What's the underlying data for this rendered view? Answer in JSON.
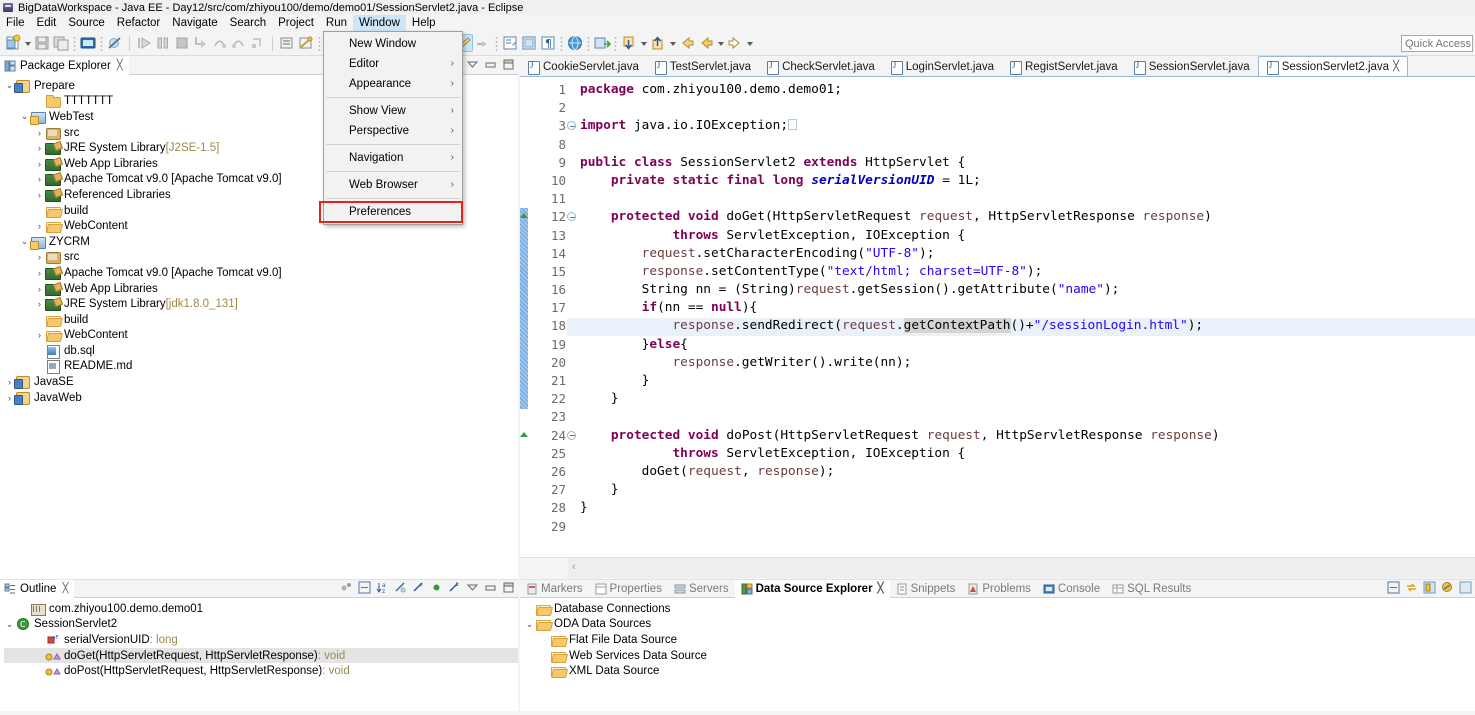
{
  "window": {
    "title": "BigDataWorkspace - Java EE - Day12/src/com/zhiyou100/demo/demo01/SessionServlet2.java - Eclipse",
    "icon": "eclipse-icon"
  },
  "menubar": {
    "items": [
      {
        "label": "File",
        "active": false
      },
      {
        "label": "Edit",
        "active": false
      },
      {
        "label": "Source",
        "active": false
      },
      {
        "label": "Refactor",
        "active": false
      },
      {
        "label": "Navigate",
        "active": false
      },
      {
        "label": "Search",
        "active": false
      },
      {
        "label": "Project",
        "active": false
      },
      {
        "label": "Run",
        "active": false
      },
      {
        "label": "Window",
        "active": true
      },
      {
        "label": "Help",
        "active": false
      }
    ]
  },
  "window_menu": {
    "open": true,
    "highlight_color": "#e8211c",
    "items": [
      {
        "label": "New Window",
        "submenu": false,
        "separator_after": false
      },
      {
        "label": "Editor",
        "submenu": true,
        "separator_after": false
      },
      {
        "label": "Appearance",
        "submenu": true,
        "separator_after": true
      },
      {
        "label": "Show View",
        "submenu": true,
        "separator_after": false
      },
      {
        "label": "Perspective",
        "submenu": true,
        "separator_after": true
      },
      {
        "label": "Navigation",
        "submenu": true,
        "separator_after": true
      },
      {
        "label": "Web Browser",
        "submenu": true,
        "separator_after": true
      },
      {
        "label": "Preferences",
        "submenu": false,
        "separator_after": false,
        "highlighted": true
      }
    ],
    "submenu_chevron": "›"
  },
  "toolbar": {
    "quick_access_placeholder": "Quick Access",
    "quick_access_value": ""
  },
  "package_explorer": {
    "tab_label": "Package Explorer",
    "close_glyph": "╳",
    "tree": [
      {
        "indent": 0,
        "twist": "v",
        "icon": "java-project-icon",
        "label": "Prepare",
        "dim": ""
      },
      {
        "indent": 2,
        "twist": "",
        "icon": "folder-icon",
        "label": "TTTTTTT",
        "dim": ""
      },
      {
        "indent": 1,
        "twist": "v",
        "icon": "web-project-icon",
        "label": "WebTest",
        "dim": ""
      },
      {
        "indent": 2,
        "twist": ">",
        "icon": "package-root-icon",
        "label": "src",
        "dim": ""
      },
      {
        "indent": 2,
        "twist": ">",
        "icon": "library-icon",
        "label": "JRE System Library",
        "dim": "[J2SE-1.5]"
      },
      {
        "indent": 2,
        "twist": ">",
        "icon": "library-icon",
        "label": "Web App Libraries",
        "dim": ""
      },
      {
        "indent": 2,
        "twist": ">",
        "icon": "library-icon",
        "label": "Apache Tomcat v9.0 [Apache Tomcat v9.0]",
        "dim": ""
      },
      {
        "indent": 2,
        "twist": ">",
        "icon": "library-icon",
        "label": "Referenced Libraries",
        "dim": ""
      },
      {
        "indent": 2,
        "twist": "",
        "icon": "folder-open-icon",
        "label": "build",
        "dim": ""
      },
      {
        "indent": 2,
        "twist": ">",
        "icon": "folder-open-icon",
        "label": "WebContent",
        "dim": ""
      },
      {
        "indent": 1,
        "twist": "v",
        "icon": "web-project-icon",
        "label": "ZYCRM",
        "dim": ""
      },
      {
        "indent": 2,
        "twist": ">",
        "icon": "package-root-icon",
        "label": "src",
        "dim": ""
      },
      {
        "indent": 2,
        "twist": ">",
        "icon": "library-icon",
        "label": "Apache Tomcat v9.0 [Apache Tomcat v9.0]",
        "dim": ""
      },
      {
        "indent": 2,
        "twist": ">",
        "icon": "library-icon",
        "label": "Web App Libraries",
        "dim": ""
      },
      {
        "indent": 2,
        "twist": ">",
        "icon": "library-icon",
        "label": "JRE System Library",
        "dim": "[jdk1.8.0_131]"
      },
      {
        "indent": 2,
        "twist": "",
        "icon": "folder-open-icon",
        "label": "build",
        "dim": ""
      },
      {
        "indent": 2,
        "twist": ">",
        "icon": "folder-open-icon",
        "label": "WebContent",
        "dim": ""
      },
      {
        "indent": 2,
        "twist": "",
        "icon": "sql-file-icon",
        "label": "db.sql",
        "dim": ""
      },
      {
        "indent": 2,
        "twist": "",
        "icon": "md-file-icon",
        "label": "README.md",
        "dim": ""
      },
      {
        "indent": 0,
        "twist": ">",
        "icon": "java-project-icon",
        "label": "JavaSE",
        "dim": ""
      },
      {
        "indent": 0,
        "twist": ">",
        "icon": "java-project-icon",
        "label": "JavaWeb",
        "dim": ""
      }
    ]
  },
  "editor": {
    "tabs": [
      {
        "label": "CookieServlet.java",
        "active": false
      },
      {
        "label": "TestServlet.java",
        "active": false
      },
      {
        "label": "CheckServlet.java",
        "active": false
      },
      {
        "label": "LoginServlet.java",
        "active": false
      },
      {
        "label": "RegistServlet.java",
        "active": false
      },
      {
        "label": "SessionServlet.java",
        "active": false
      },
      {
        "label": "SessionServlet2.java",
        "active": true
      }
    ],
    "active_tab_close": "╳",
    "current_line": 18,
    "line_numbers": [
      "1",
      "2",
      "3",
      "8",
      "9",
      "10",
      "11",
      "12",
      "13",
      "14",
      "15",
      "16",
      "17",
      "18",
      "19",
      "20",
      "21",
      "22",
      "23",
      "24",
      "25",
      "26",
      "27",
      "28",
      "29"
    ],
    "code_lines": [
      "package com.zhiyou100.demo.demo01;",
      "",
      "import java.io.IOException;",
      "",
      "public class SessionServlet2 extends HttpServlet {",
      "    private static final long serialVersionUID = 1L;",
      "",
      "    protected void doGet(HttpServletRequest request, HttpServletResponse response)",
      "            throws ServletException, IOException {",
      "        request.setCharacterEncoding(\"UTF-8\");",
      "        response.setContentType(\"text/html; charset=UTF-8\");",
      "        String nn = (String)request.getSession().getAttribute(\"name\");",
      "        if(nn == null){",
      "            response.sendRedirect(request.getContextPath()+\"/sessionLogin.html\");",
      "        }else{",
      "            response.getWriter().write(nn);",
      "        }",
      "    }",
      "",
      "    protected void doPost(HttpServletRequest request, HttpServletResponse response)",
      "            throws ServletException, IOException {",
      "        doGet(request, response);",
      "    }",
      "}",
      ""
    ]
  },
  "outline": {
    "tab_label": "Outline",
    "close_glyph": "╳",
    "items": [
      {
        "indent": 1,
        "twist": "",
        "icon": "package-icon",
        "label": "com.zhiyou100.demo.demo01",
        "type": "",
        "selected": false
      },
      {
        "indent": 0,
        "twist": "v",
        "icon": "class-icon",
        "label": "SessionServlet2",
        "type": "",
        "selected": false
      },
      {
        "indent": 2,
        "twist": "",
        "icon": "field-static-final-icon",
        "label": "serialVersionUID",
        "type": " : long",
        "selected": false
      },
      {
        "indent": 2,
        "twist": "",
        "icon": "method-protected-icon",
        "label": "doGet(HttpServletRequest, HttpServletResponse)",
        "type": " : void",
        "selected": true
      },
      {
        "indent": 2,
        "twist": "",
        "icon": "method-protected-icon",
        "label": "doPost(HttpServletRequest, HttpServletResponse)",
        "type": " : void",
        "selected": false
      }
    ]
  },
  "bottom_panel": {
    "tabs": [
      {
        "label": "Markers",
        "icon": "markers-icon",
        "selected": false
      },
      {
        "label": "Properties",
        "icon": "properties-icon",
        "selected": false
      },
      {
        "label": "Servers",
        "icon": "servers-icon",
        "selected": false
      },
      {
        "label": "Data Source Explorer",
        "icon": "data-source-explorer-icon",
        "selected": true
      },
      {
        "label": "Snippets",
        "icon": "snippets-icon",
        "selected": false
      },
      {
        "label": "Problems",
        "icon": "problems-icon",
        "selected": false
      },
      {
        "label": "Console",
        "icon": "console-icon",
        "selected": false
      },
      {
        "label": "SQL Results",
        "icon": "sql-results-icon",
        "selected": false
      }
    ],
    "active_tab_close": "╳",
    "tree": [
      {
        "indent": 0,
        "twist": "",
        "icon": "folder-open-icon",
        "label": "Database Connections"
      },
      {
        "indent": 0,
        "twist": "v",
        "icon": "folder-open-icon",
        "label": "ODA Data Sources"
      },
      {
        "indent": 1,
        "twist": "",
        "icon": "folder-open-icon",
        "label": "Flat File Data Source"
      },
      {
        "indent": 1,
        "twist": "",
        "icon": "folder-open-icon",
        "label": "Web Services Data Source"
      },
      {
        "indent": 1,
        "twist": "",
        "icon": "folder-open-icon",
        "label": "XML Data Source"
      }
    ]
  },
  "colors": {
    "menu_highlight": "#cde6f7",
    "selection_red": "#e8211c",
    "current_line": "#e9f2fb",
    "keyword": "#7f0055",
    "string": "#2a00ff",
    "field": "#0000c0",
    "parameter": "#6a3e3e",
    "change_bar": "#7aade0"
  }
}
